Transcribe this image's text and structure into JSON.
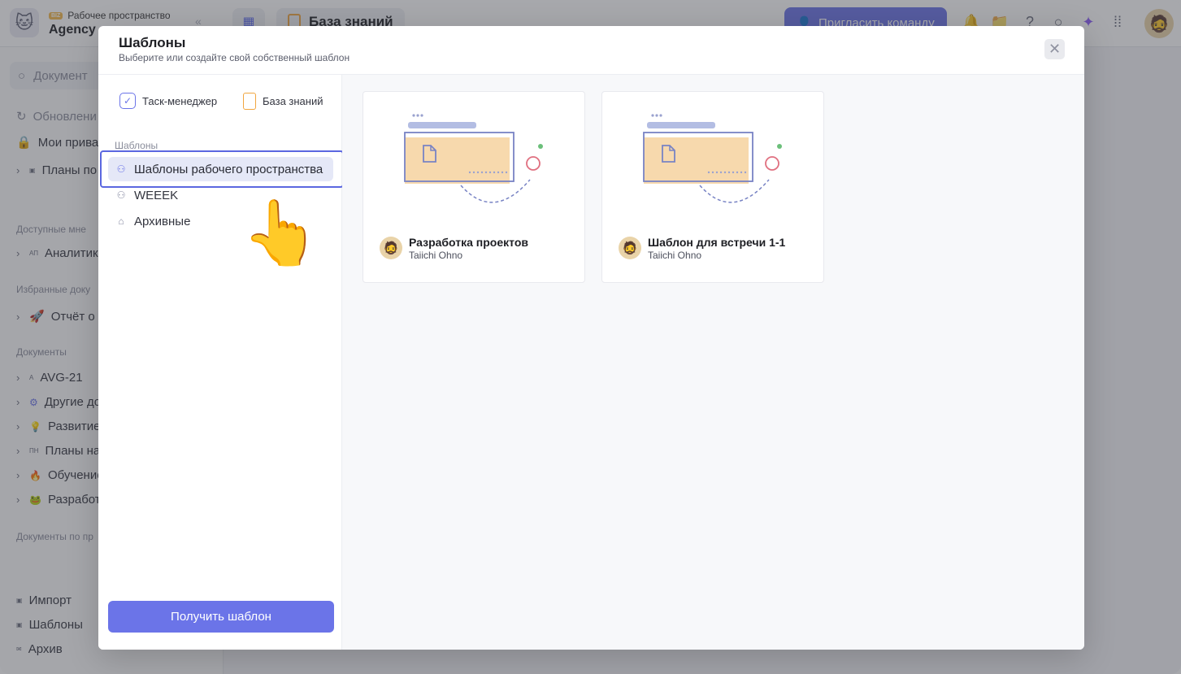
{
  "workspace": {
    "badge": "BIZ",
    "label": "Рабочее пространство",
    "name": "Agency"
  },
  "topbar": {
    "breadcrumb": "База знаний",
    "invite_button": "Пригласить команду"
  },
  "sidebar": {
    "search_placeholder": "Документ",
    "items_top": [
      "Обновлени",
      "Мои прива",
      "Планы по"
    ],
    "section_shared": "Доступные мне",
    "shared_items": [
      {
        "prefix": "АП",
        "label": "Аналитика"
      }
    ],
    "section_favorites": "Избранные доку",
    "favorite_items": [
      {
        "prefix": "🚀",
        "label": "Отчёт о к"
      }
    ],
    "section_documents": "Документы",
    "document_items": [
      {
        "prefix": "A",
        "label": "AVG-21"
      },
      {
        "prefix": "⚙",
        "label": "Другие до"
      },
      {
        "prefix": "💡",
        "label": "Развитие"
      },
      {
        "prefix": "ПН",
        "label": "Планы на"
      },
      {
        "prefix": "🔥",
        "label": "Обучение"
      },
      {
        "prefix": "🐸",
        "label": "Разработ"
      }
    ],
    "section_docs_by": "Документы по пр",
    "bottom_items": [
      "Импорт",
      "Шаблоны",
      "Архив"
    ]
  },
  "modal": {
    "title": "Шаблоны",
    "subtitle": "Выберите или создайте свой собственный шаблон",
    "close_icon": "close-icon",
    "sources": [
      {
        "label": "Таск-менеджер",
        "icon": "checkbox-icon"
      },
      {
        "label": "База знаний",
        "icon": "document-icon"
      }
    ],
    "section_label": "Шаблоны",
    "template_groups": [
      {
        "label": "Шаблоны рабочего пространства",
        "icon": "users-icon",
        "active": true
      },
      {
        "label": "WEEEK",
        "icon": "users-icon",
        "active": false
      },
      {
        "label": "Архивные",
        "icon": "archive-icon",
        "active": false
      }
    ],
    "get_button": "Получить шаблон",
    "cards": [
      {
        "title": "Разработка проектов",
        "author": "Taiichi Ohno"
      },
      {
        "title": "Шаблон для встречи 1-1",
        "author": "Taiichi Ohno"
      }
    ]
  },
  "colors": {
    "accent": "#6b74e8",
    "highlight_border": "#5b67e0",
    "doc_orange": "#f1a640",
    "card_fill": "#f7d9ad",
    "card_frame": "#7883c4",
    "dot_green": "#6bbf7a",
    "circle_red": "#e07080"
  }
}
